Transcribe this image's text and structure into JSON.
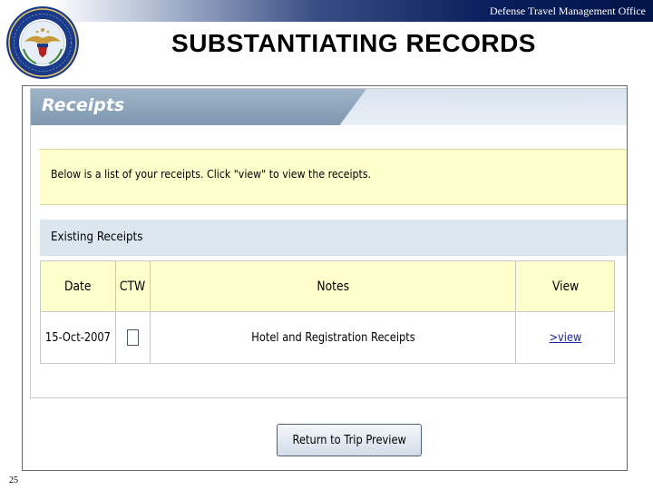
{
  "banner": {
    "office": "Defense Travel Management Office"
  },
  "seal": {
    "text": "Defense Travel Management Office · Department of Defense"
  },
  "slide": {
    "title": "SUBSTANTIATING  RECORDS",
    "page_number": "25"
  },
  "receipts": {
    "title": "Receipts",
    "info": "Below is a list of your receipts. Click \"view\" to view the receipts.",
    "existing_title": "Existing Receipts",
    "columns": {
      "date": "Date",
      "ctw": "CTW",
      "notes": "Notes",
      "view": "View"
    },
    "rows": [
      {
        "date": "15-Oct-2007",
        "notes": "Hotel and Registration Receipts",
        "view_link": ">view"
      }
    ]
  },
  "button": {
    "return_label": "Return to Trip Preview"
  },
  "colors": {
    "banner_dark": "#001448",
    "info_bg": "#ffffcc",
    "section_bg": "#dce6ee",
    "tab_bg": "#8fa7bd",
    "link": "#1a2aa0"
  }
}
